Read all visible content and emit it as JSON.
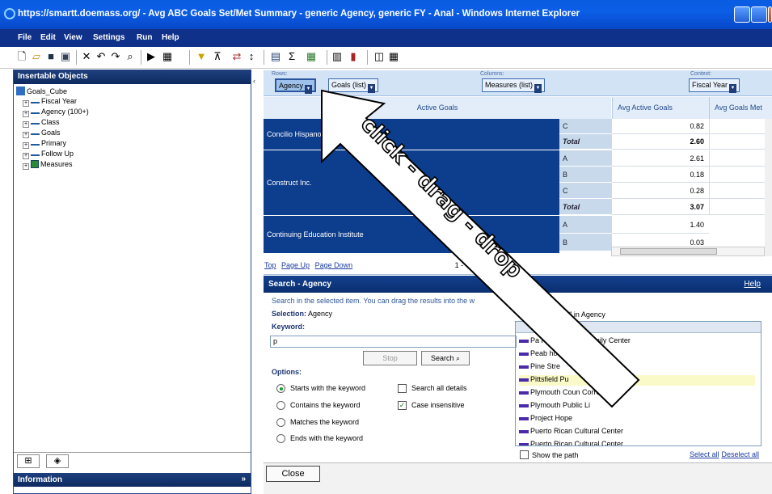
{
  "window": {
    "title": "https://smartt.doemass.org/ - Avg ABC Goals Set/Met Summary - generic Agency, generic FY - Anal - Windows Internet Explorer"
  },
  "menu": [
    "File",
    "Edit",
    "View",
    "Settings",
    "Run",
    "Help"
  ],
  "left_panel": {
    "title": "Insertable Objects",
    "root": "Goals_Cube",
    "items": [
      "Fiscal Year",
      "Agency (100+)",
      "Class",
      "Goals",
      "Primary",
      "Follow Up",
      "Measures"
    ],
    "info_title": "Information"
  },
  "dropzones": {
    "rows_label": "Rows:",
    "columns_label": "Columns:",
    "context_label": "Context:",
    "rows_chips": [
      "Agency",
      "Goals (list)"
    ],
    "columns_chip": "Measures (list)",
    "context_chip": "Fiscal Year"
  },
  "grid": {
    "header": "Active Goals",
    "col1": "Avg Active Goals",
    "col2": "Avg Goals Met",
    "rows": [
      {
        "name": "Concilio Hispano de C",
        "sub": [
          "C",
          "Total"
        ],
        "vals": [
          "0.82",
          "2.60"
        ]
      },
      {
        "name": "Construct Inc.",
        "sub": [
          "A",
          "B",
          "C",
          "Total"
        ],
        "vals": [
          "2.61",
          "0.18",
          "0.28",
          "3.07"
        ]
      },
      {
        "name": "Continuing Education Institute",
        "sub": [
          "A",
          "B"
        ],
        "vals": [
          "1.40",
          "0.03"
        ]
      }
    ]
  },
  "pager": {
    "top": "Top",
    "page_up": "Page Up",
    "page_down": "Page Down",
    "count": "1 -"
  },
  "search": {
    "title": "Search - Agency",
    "help": "Help",
    "desc": "Search in the selected item. You can drag the results into the w",
    "selection_label": "Selection:",
    "selection_value": "Agency",
    "keyword_label": "Keyword:",
    "keyword_value": "p",
    "stop": "Stop",
    "search": "Search",
    "options_label": "Options:",
    "options": [
      "Starts with the keyword",
      "Contains the keyword",
      "Matches the keyword",
      "Ends with the keyword"
    ],
    "search_all": "Search all details",
    "case_insensitive": "Case insensitive",
    "results_caption": "\"p\" in Agency",
    "results": [
      "Pa            l Care Works Family Center",
      "Peab         hools",
      "Pine Stre",
      "Pittsfield Pu",
      "Plymouth Coun            Correction",
      "Plymouth Public Li",
      "Project Hope",
      "Puerto Rican Cultural Center",
      "Puerto Rican Cultural Center"
    ],
    "show_path": "Show the path",
    "select_all": "Select all",
    "deselect_all": "Deselect all",
    "close": "Close"
  },
  "annotation": {
    "text": "click - drag - drop"
  },
  "colors": {
    "accent": "#0d3d8d",
    "arrow_fill": "#ffffff",
    "title_bar": "#0b5ee6"
  }
}
